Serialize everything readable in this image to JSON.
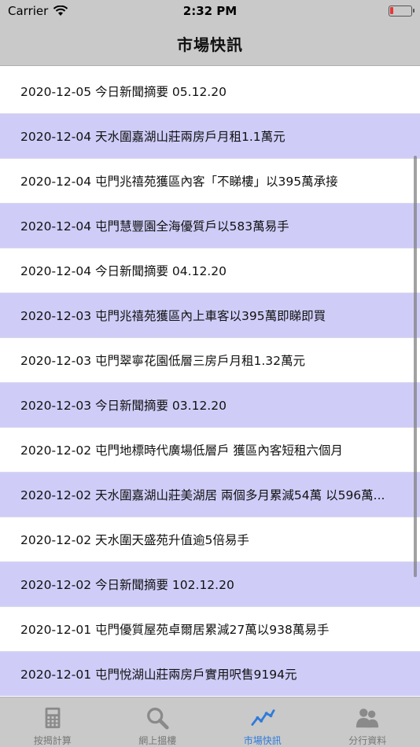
{
  "status": {
    "carrier": "Carrier",
    "time": "2:32 PM"
  },
  "nav": {
    "title": "市場快訊"
  },
  "news": [
    "2020-12-05 今日新聞摘要 05.12.20",
    "2020-12-04 天水圍嘉湖山莊兩房戶月租1.1萬元",
    "2020-12-04 屯門兆禧苑獲區內客「不睇樓」以395萬承接",
    "2020-12-04 屯門慧豐園全海優質戶以583萬易手",
    "2020-12-04 今日新聞摘要 04.12.20",
    "2020-12-03 屯門兆禧苑獲區內上車客以395萬即睇即買",
    "2020-12-03 屯門翠寧花園低層三房戶月租1.32萬元",
    "2020-12-03 今日新聞摘要 03.12.20",
    "2020-12-02 屯門地標時代廣場低層戶 獲區內客短租六個月",
    "2020-12-02 天水圍嘉湖山莊美湖居 兩個多月累減54萬 以596萬...",
    "2020-12-02 天水圍天盛苑升值逾5倍易手",
    "2020-12-02 今日新聞摘要 102.12.20",
    "2020-12-01 屯門優質屋苑卓爾居累減27萬以938萬易手",
    "2020-12-01 屯門悅湖山莊兩房戶實用呎售9194元"
  ],
  "tabs": [
    {
      "label": "按揭計算",
      "icon": "calculator-icon"
    },
    {
      "label": "網上搵樓",
      "icon": "magnifier-icon"
    },
    {
      "label": "市場快訊",
      "icon": "line-chart-icon"
    },
    {
      "label": "分行資料",
      "icon": "people-icon"
    }
  ],
  "colors": {
    "row_alt": "#cfcdf8",
    "active_tab": "#2f7bd9",
    "bars": "#c9c9c9"
  }
}
